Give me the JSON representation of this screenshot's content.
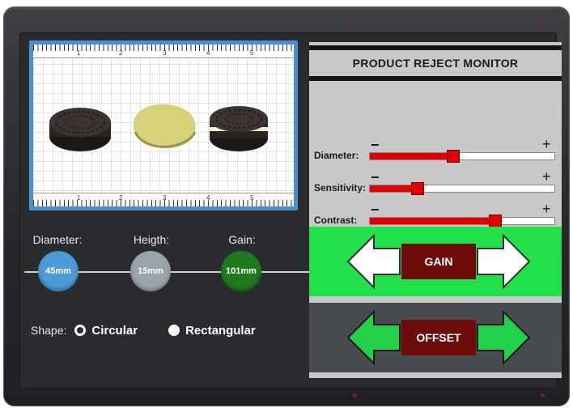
{
  "camera": {
    "ruler_numbers": [
      "1",
      "2",
      "3",
      "4",
      "5"
    ],
    "items": [
      {
        "name": "chocolate-cookie",
        "color": "#2a2420"
      },
      {
        "name": "yellow-disc",
        "color": "#d6d27a"
      },
      {
        "name": "sandwich-cookie",
        "color": "#302a26"
      }
    ]
  },
  "readouts": {
    "diameter": {
      "label": "Diameter:",
      "value": "45mm",
      "color": "#4a9bd6"
    },
    "height": {
      "label": "Heigth:",
      "value": "15mm",
      "color": "#9aa4ab"
    },
    "gain": {
      "label": "Gain:",
      "value": "101mm",
      "color": "#1f7a1f"
    }
  },
  "shape": {
    "label": "Shape:",
    "options": [
      {
        "label": "Circular",
        "selected": false
      },
      {
        "label": "Rectangular",
        "selected": true
      }
    ]
  },
  "monitor": {
    "title": "PRODUCT REJECT MONITOR",
    "minus": "−",
    "plus": "+",
    "sliders": [
      {
        "label": "Diameter:",
        "value": 0.45
      },
      {
        "label": "Sensitivity:",
        "value": 0.26
      },
      {
        "label": "Contrast:",
        "value": 0.68
      }
    ]
  },
  "controls": {
    "gain_label": "GAIN",
    "offset_label": "OFFSET",
    "gain_band_color": "#22e04c",
    "offset_band_color": "#484b50",
    "button_color": "#6e0b0b"
  }
}
